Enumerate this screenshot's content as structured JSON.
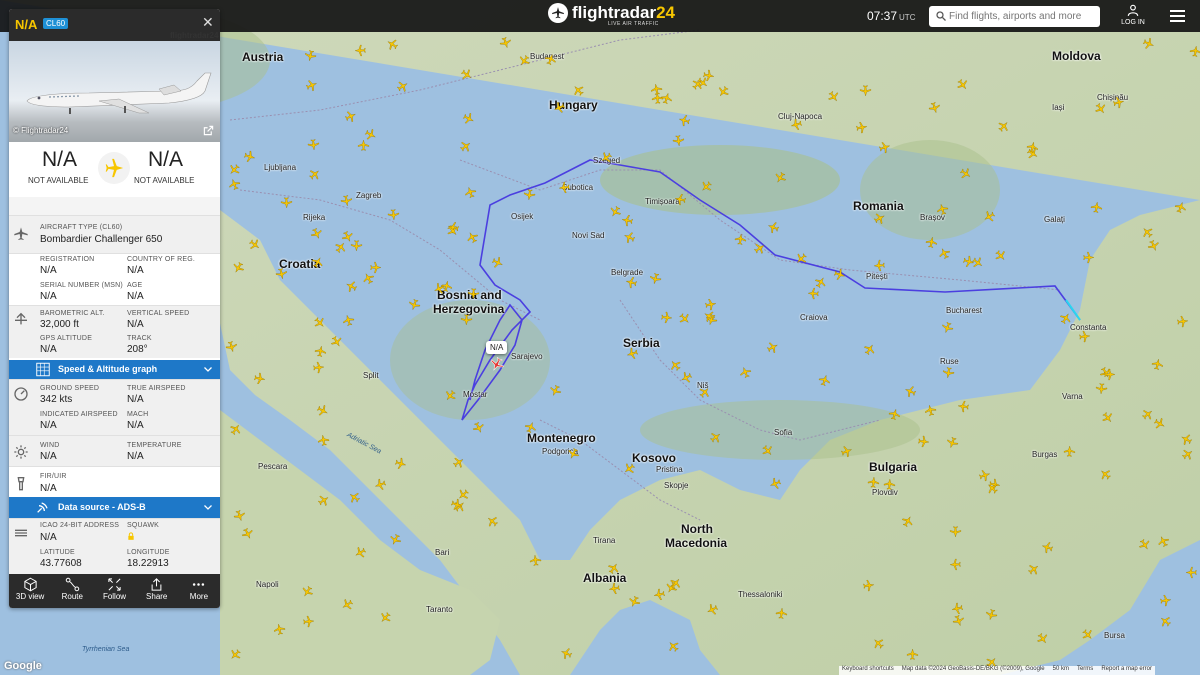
{
  "header": {
    "brand_name": "flightradar",
    "brand_num": "24",
    "brand_sub": "LIVE AIR TRAFFIC",
    "time": "07:37",
    "tz": "UTC",
    "search_placeholder": "Find flights, airports and more",
    "login_label": "LOG IN"
  },
  "flight": {
    "callsign": "N/A",
    "type_code": "CL60",
    "panel_logo": "flightradar24",
    "photo_credit": "© Flightradar24",
    "origin_code": "N/A",
    "origin_name": "NOT AVAILABLE",
    "dest_code": "N/A",
    "dest_name": "NOT AVAILABLE",
    "aircraft_type_label": "AIRCRAFT TYPE (CL60)",
    "aircraft_type": "Bombardier Challenger 650",
    "registration_label": "REGISTRATION",
    "registration": "N/A",
    "country_label": "COUNTRY OF REG.",
    "country": "N/A",
    "serial_label": "SERIAL NUMBER (MSN)",
    "serial": "N/A",
    "age_label": "AGE",
    "age": "N/A",
    "baro_label": "BAROMETRIC ALT.",
    "baro": "32,000 ft",
    "vspeed_label": "VERTICAL SPEED",
    "vspeed": "N/A",
    "gps_label": "GPS ALTITUDE",
    "gps": "N/A",
    "track_label": "TRACK",
    "track": "208°",
    "speed_graph_label": "Speed & Altitude graph",
    "gs_label": "GROUND SPEED",
    "gs": "342 kts",
    "tas_label": "TRUE AIRSPEED",
    "tas": "N/A",
    "ias_label": "INDICATED AIRSPEED",
    "ias": "N/A",
    "mach_label": "MACH",
    "mach": "N/A",
    "wind_label": "WIND",
    "wind": "N/A",
    "temp_label": "TEMPERATURE",
    "temp": "N/A",
    "fir_label": "FIR/UIR",
    "fir": "N/A",
    "source_label": "Data source - ADS-B",
    "icao_label": "ICAO 24-BIT ADDRESS",
    "icao": "N/A",
    "squawk_label": "SQUAWK",
    "lat_label": "LATITUDE",
    "lat": "43.77608",
    "lon_label": "LONGITUDE",
    "lon": "18.22913",
    "tag": "N/A"
  },
  "footer_buttons": [
    "3D view",
    "Route",
    "Follow",
    "Share",
    "More"
  ],
  "map_labels": {
    "austria": "Austria",
    "hungary": "Hungary",
    "romania": "Romania",
    "moldova": "Moldova",
    "croatia": "Croatia",
    "bosnia1": "Bosnia and",
    "bosnia2": "Herzegovina",
    "serbia": "Serbia",
    "montenegro": "Montenegro",
    "kosovo": "Kosovo",
    "bulgaria": "Bulgaria",
    "north1": "North",
    "north2": "Macedonia",
    "albania": "Albania",
    "budapest": "Budapest",
    "szeged": "Szeged",
    "timisoara": "Timișoara",
    "cluj": "Cluj-Napoca",
    "zagreb": "Zagreb",
    "ljubljana": "Ljubljana",
    "belgrade": "Belgrade",
    "sarajevo": "Sarajevo",
    "bucharest": "Bucharest",
    "constanta": "Constanta",
    "varna": "Varna",
    "sofia": "Sofia",
    "skopje": "Skopje",
    "plovdiv": "Plovdiv",
    "thessaloniki": "Thessaloniki",
    "chisinau": "Chișinău",
    "brasov": "Brașov",
    "pitesti": "Pitești",
    "craiova": "Craiova",
    "nis": "Niš",
    "podgorica": "Podgorica",
    "tirana": "Tirana",
    "split": "Split",
    "rijeka": "Rijeka",
    "novisad": "Novi Sad",
    "subotica": "Subotica",
    "osijek": "Osijek",
    "adriatic": "Adriatic Sea",
    "tyrrhenian": "Tyrrhenian Sea",
    "pescara": "Pescara",
    "taranto": "Taranto",
    "bari": "Bari",
    "naples": "Napoli",
    "iasi": "Iași",
    "galati": "Galați",
    "ruse": "Ruse",
    "burgas": "Burgas",
    "bursa": "Bursa",
    "pristina": "Pristina",
    "mostar": "Mostar"
  },
  "attribution": [
    "Keyboard shortcuts",
    "Map data ©2024 GeoBasis-DE/BKG (©2009), Google",
    "50 km",
    "Terms",
    "Report a map error"
  ],
  "google_logo": "Google",
  "colors": {
    "accent": "#f7c600",
    "panel_header": "#2b2b2b",
    "section_blue": "#1e78c8",
    "track_line": "#4b3fe0"
  }
}
